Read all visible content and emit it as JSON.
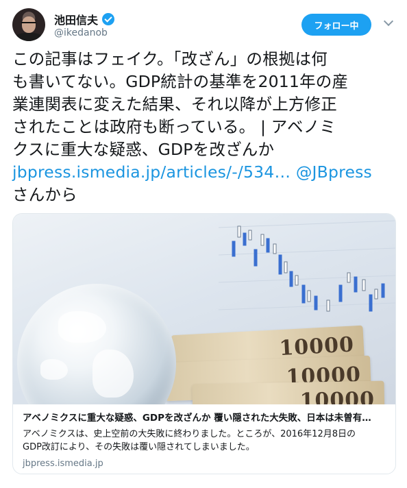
{
  "user": {
    "name": "池田信夫",
    "handle": "@ikedanob",
    "follow_label": "フォロー中"
  },
  "tweet": {
    "lines": [
      "この記事はフェイク。「改ざん」の根拠は何",
      "も書いてない。GDP統計の基準を2011年の産",
      "業連関表に変えた結果、それ以降が上方修正",
      "されたことは政府も断っている。 | アベノミ",
      "クスに重大な疑惑、GDPを改ざんか"
    ],
    "link_url": "jbpress.ismedia.jp/articles/-/534…",
    "link_mention": "@JBpress",
    "suffix": "さんから"
  },
  "card": {
    "image_numbers": [
      "10000",
      "10000",
      "10000"
    ],
    "title": "アベノミクスに重大な疑惑、GDPを改ざんか 覆い隠された大失敗、日本は未曽有…",
    "description_lines": [
      "アベノミクスは、史上空前の大失敗に終わりました。ところが、2016年12月8日の",
      "GDP改訂により、その失敗は覆い隠されてしまいました。"
    ],
    "domain": "jbpress.ismedia.jp"
  },
  "colors": {
    "accent": "#1da1f2",
    "link": "#1b95e0",
    "text": "#14171a",
    "muted": "#657786",
    "border": "#e1e8ed"
  }
}
